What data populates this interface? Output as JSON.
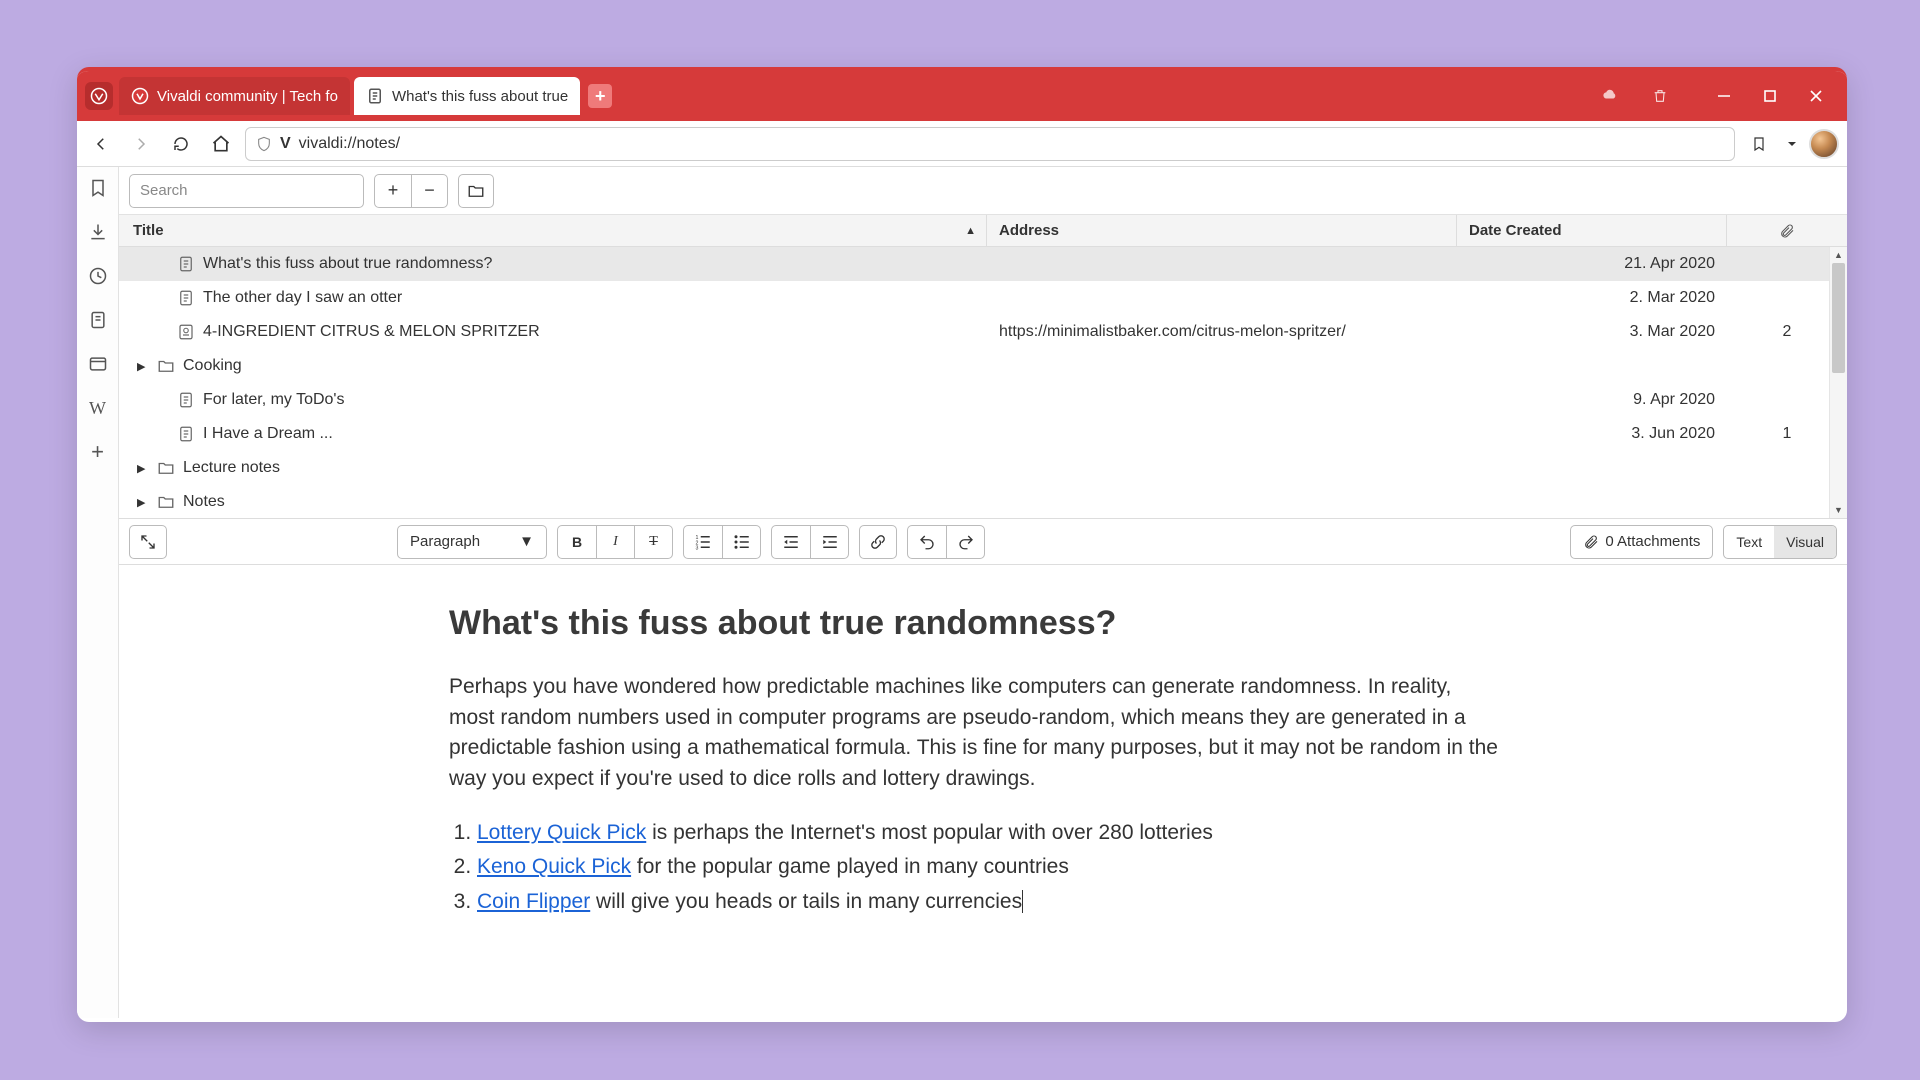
{
  "tabs": [
    {
      "title": "Vivaldi community | Tech fo",
      "active": false
    },
    {
      "title": "What's this fuss about true",
      "active": true
    }
  ],
  "addressbar": {
    "url": "vivaldi://notes/"
  },
  "notes_toolbar": {
    "search_placeholder": "Search"
  },
  "columns": {
    "title": "Title",
    "address": "Address",
    "date": "Date Created"
  },
  "notes": [
    {
      "type": "note",
      "title": "What's this fuss about true randomness?",
      "address": "",
      "date": "21. Apr 2020",
      "attach": "",
      "selected": true,
      "indent": 1
    },
    {
      "type": "note",
      "title": "The other day I saw an otter",
      "address": "",
      "date": "2. Mar 2020",
      "attach": "",
      "indent": 1
    },
    {
      "type": "web",
      "title": "4-INGREDIENT CITRUS & MELON SPRITZER",
      "address": "https://minimalistbaker.com/citrus-melon-spritzer/",
      "date": "3. Mar 2020",
      "attach": "2",
      "indent": 1
    },
    {
      "type": "folder",
      "title": "Cooking",
      "address": "",
      "date": "",
      "attach": "",
      "indent": 0
    },
    {
      "type": "note",
      "title": "For later, my ToDo's",
      "address": "",
      "date": "9. Apr 2020",
      "attach": "",
      "indent": 1
    },
    {
      "type": "note",
      "title": "I Have a Dream ...",
      "address": "",
      "date": "3. Jun 2020",
      "attach": "1",
      "indent": 1
    },
    {
      "type": "folder",
      "title": "Lecture notes",
      "address": "",
      "date": "",
      "attach": "",
      "indent": 0
    },
    {
      "type": "folder",
      "title": "Notes",
      "address": "",
      "date": "",
      "attach": "",
      "indent": 0
    }
  ],
  "editor_toolbar": {
    "paragraph_label": "Paragraph",
    "attachments_label": "0 Attachments",
    "text_label": "Text",
    "visual_label": "Visual"
  },
  "note_content": {
    "title": "What's this fuss about true randomness?",
    "paragraph": "Perhaps you have wondered how predictable machines like computers can generate randomness. In reality, most random numbers used in computer programs are pseudo-random, which means they are generated in a predictable fashion using a mathematical formula. This is fine for many purposes, but it may not be random in the way you expect if you're used to dice rolls and lottery drawings.",
    "list": [
      {
        "link": "Lottery Quick Pick",
        "rest": " is perhaps the Internet's most popular with over 280 lotteries"
      },
      {
        "link": "Keno Quick Pick",
        "rest": " for the popular game played in many countries"
      },
      {
        "link": "Coin Flipper",
        "rest": " will give you heads or tails in many currencies"
      }
    ]
  }
}
